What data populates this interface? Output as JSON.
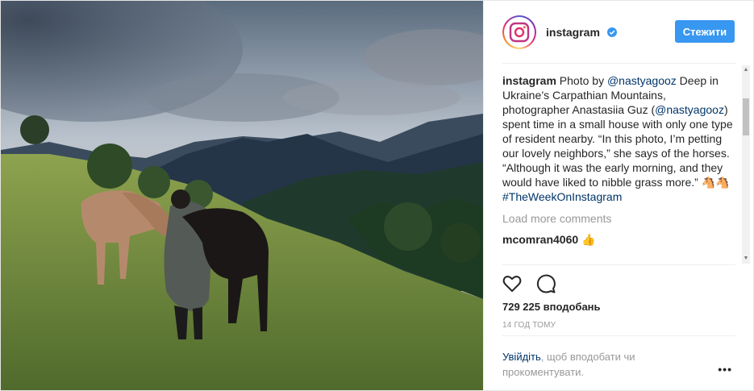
{
  "colors": {
    "follow_button": "#3897f0",
    "link": "#003569",
    "verified_badge": "#3897f0",
    "muted": "#999999"
  },
  "photo": {
    "subject": "woman petting two horses on a mountain meadow"
  },
  "header": {
    "username": "instagram",
    "avatar_icon": "instagram-logo-icon",
    "verified_icon": "verified-badge-icon",
    "follow_label": "Стежити"
  },
  "caption": {
    "username": "instagram",
    "text_1": " Photo by ",
    "mention": "@nastyagooz",
    "text_2": " Deep in Ukraine’s Carpathian Mountains, photographer Anastasiia Guz (",
    "mention_2": "@nastyagooz",
    "text_3": ") spent time in a small house with only one type of resident nearby. “In this photo, I’m petting our lovely neighbors,” she says of the horses. “Although it was the early morning, and they would have liked to nibble grass more.” ",
    "emoji": "🐴🐴",
    "hashtag": "#TheWeekOnInstagram"
  },
  "load_more": "Load more comments",
  "comments": [
    {
      "username": "mcomran4060",
      "text": " 👍"
    }
  ],
  "actions": {
    "like_icon": "heart-icon",
    "comment_icon": "comment-icon"
  },
  "likes": "729 225 вподобань",
  "timestamp": "14 ГОД ТОМУ",
  "login_prompt": {
    "link": "Увійдіть",
    "text": ", щоб вподобати чи прокоментувати."
  },
  "more_icon": "more-options-icon",
  "more_label": "•••"
}
